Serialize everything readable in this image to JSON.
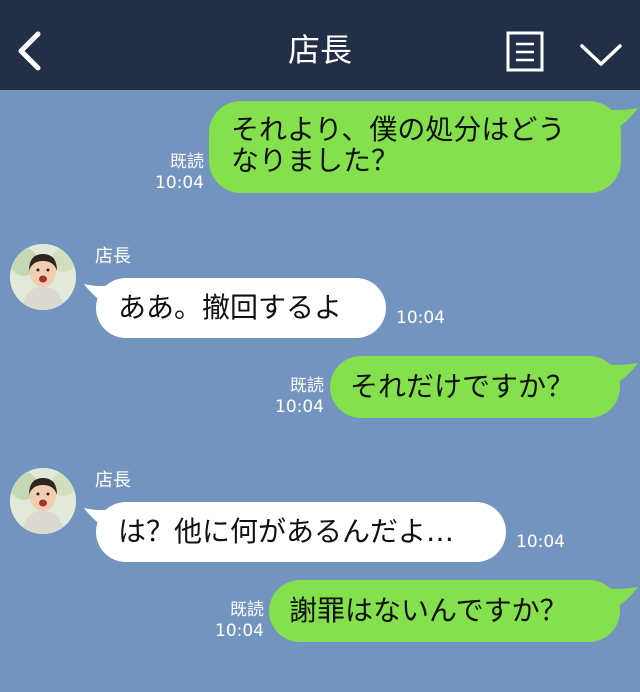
{
  "header": {
    "title": "店長",
    "back_icon": "chevron-left-icon",
    "menu_icon": "document-list-icon",
    "collapse_icon": "chevron-down-icon"
  },
  "messages": [
    {
      "side": "me",
      "lines": [
        "それより、僕の処分はどう",
        "なりました？"
      ],
      "read": "既読",
      "time": "10:04"
    },
    {
      "side": "other",
      "sender": "店長",
      "text": "ああ。撤回するよ",
      "time": "10:04"
    },
    {
      "side": "me",
      "text": "それだけですか？",
      "read": "既読",
      "time": "10:04"
    },
    {
      "side": "other",
      "sender": "店長",
      "text": "は？他に何があるんだよ…",
      "time": "10:04"
    },
    {
      "side": "me",
      "text": "謝罪はないんですか？",
      "read": "既読",
      "time": "10:04"
    }
  ],
  "colors": {
    "background": "#7494c0",
    "header": "#232f47",
    "bubble_me": "#84e04c",
    "bubble_other": "#ffffff"
  }
}
